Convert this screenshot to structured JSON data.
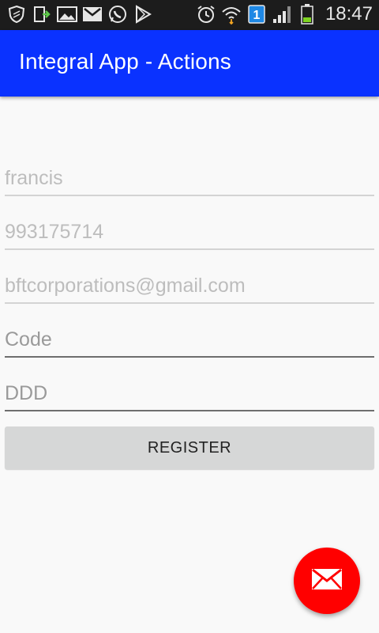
{
  "statusbar": {
    "time": "18:47",
    "notification_icons": [
      "shield-icon",
      "sync-icon",
      "gallery-icon",
      "gmail-icon",
      "whatsapp-icon",
      "play-store-icon"
    ],
    "system_icons": [
      "alarm-icon",
      "wifi-icon",
      "notification-count-icon",
      "signal-icon",
      "battery-icon"
    ],
    "badge_count": "1"
  },
  "appbar": {
    "title": "Integral App - Actions",
    "color": "#0a32ff"
  },
  "form": {
    "name_value": "francis",
    "phone_value": "993175714",
    "email_value": "bftcorporations@gmail.com",
    "code_placeholder": "Code",
    "ddd_placeholder": "DDD",
    "register_label": "REGISTER"
  },
  "fab": {
    "icon": "mail-icon",
    "color": "#ff0000"
  }
}
